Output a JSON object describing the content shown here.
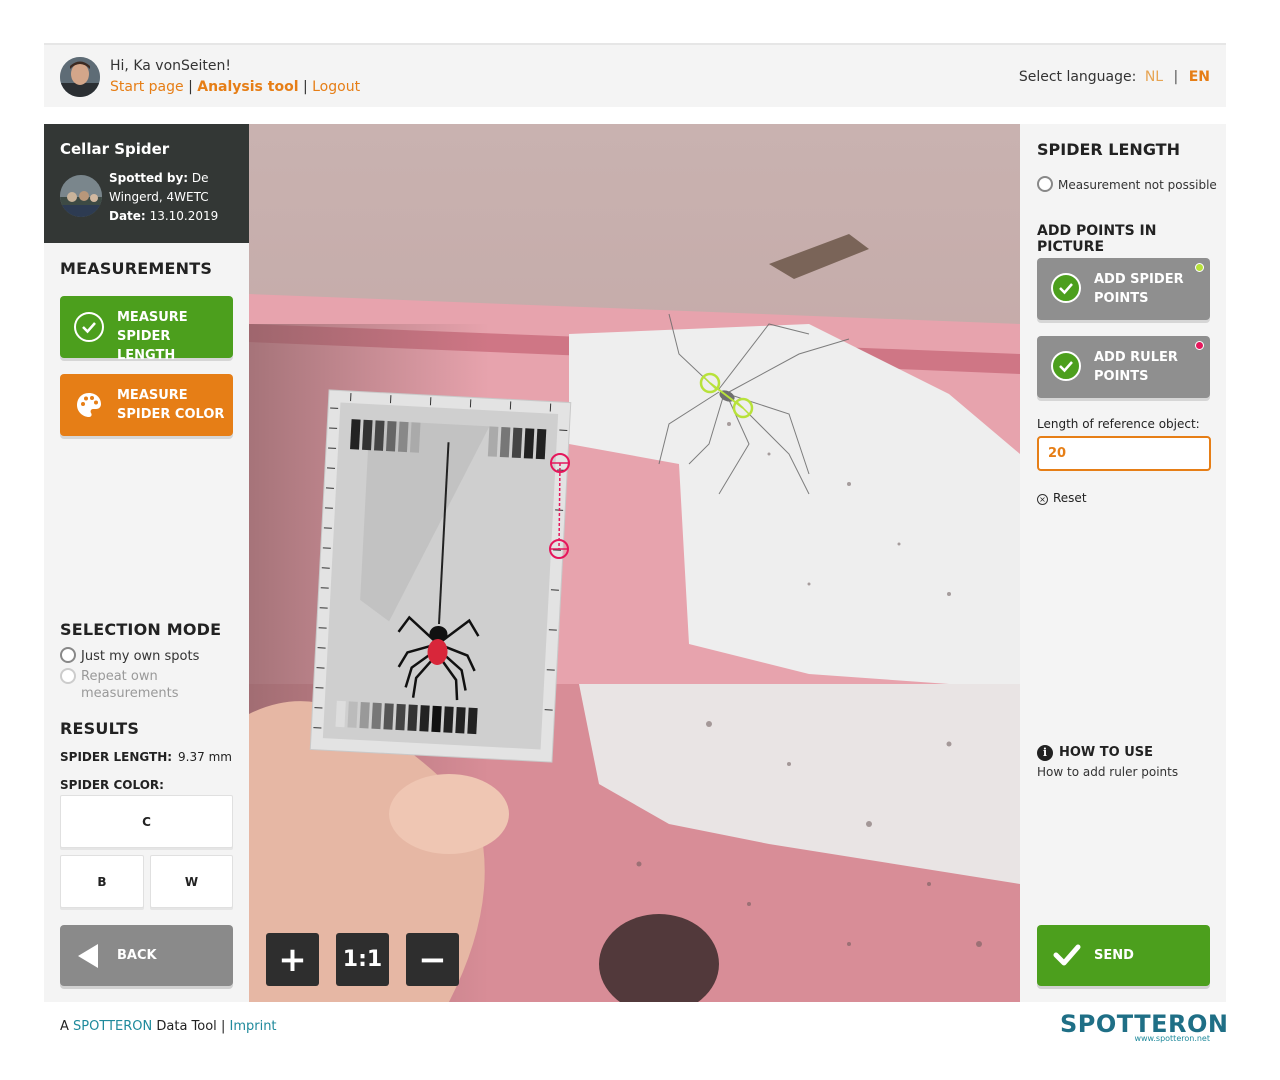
{
  "header": {
    "greeting": "Hi, Ka vonSeiten!",
    "nav": {
      "start": "Start page",
      "analysis": "Analysis tool",
      "logout": "Logout",
      "sep": " | "
    },
    "language": {
      "label": "Select language:",
      "nl": "NL",
      "en": "EN",
      "sep": "|"
    }
  },
  "spot": {
    "title": "Cellar Spider",
    "spotted_by_label": "Spotted by:",
    "spotted_by_value": "De Wingerd, 4WETC",
    "date_label": "Date:",
    "date_value": "13.10.2019"
  },
  "measurements": {
    "title": "MEASUREMENTS",
    "length_button": "MEASURE SPIDER LENGTH",
    "color_button": "MEASURE SPIDER COLOR"
  },
  "selection_mode": {
    "title": "SELECTION MODE",
    "options": [
      "Just my own spots",
      "Repeat own measurements"
    ]
  },
  "results": {
    "title": "RESULTS",
    "length_label": "SPIDER LENGTH:",
    "length_value": "9.37 mm",
    "color_label": "SPIDER COLOR:",
    "colors": [
      "C",
      "B",
      "W"
    ]
  },
  "back_button": "BACK",
  "zoom": {
    "in": "+",
    "reset": "1:1",
    "out": "−"
  },
  "spider_length": {
    "title": "SPIDER LENGTH",
    "not_possible": "Measurement not possible",
    "add_points_title": "ADD POINTS IN PICTURE",
    "spider_points_button": "ADD SPIDER POINTS",
    "ruler_points_button": "ADD RULER POINTS",
    "ref_label": "Length of reference object:",
    "ref_value": "20",
    "reset": "Reset",
    "howto_title": "HOW TO USE",
    "howto_link": "How to add ruler points",
    "send_button": "SEND"
  },
  "colors": {
    "accent_orange": "#e67e16",
    "accent_green": "#4c9f1d",
    "spider_point": "#b8e23a",
    "ruler_point": "#e5175c",
    "panel_bg": "#f4f4f4",
    "dark_card": "#333735"
  },
  "footer": {
    "prefix": "A",
    "brand": "SPOTTERON",
    "suffix": "Data Tool",
    "sep": "|",
    "imprint": "Imprint"
  },
  "logo": {
    "word": "SPOTTERON",
    "url": "www.spotteron.net"
  }
}
